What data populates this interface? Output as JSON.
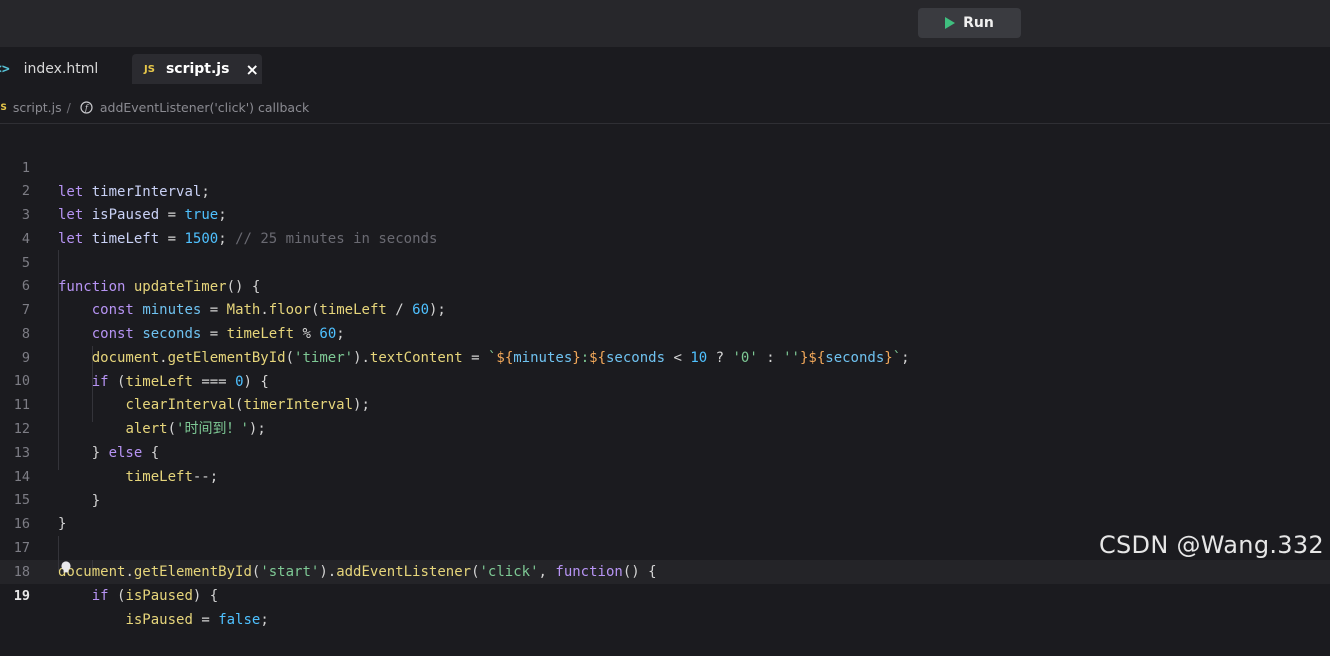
{
  "toolbar": {
    "run_label": "Run"
  },
  "tabs": [
    {
      "label": "index.html",
      "icon": "html-tag-icon",
      "icon_text": "<>"
    },
    {
      "label": "script.js",
      "icon": "js-file-icon",
      "icon_text": "JS",
      "active": true
    }
  ],
  "breadcrumb": {
    "file_badge": "JS",
    "file": "script.js",
    "separator": "/",
    "symbol": "addEventListener('click') callback"
  },
  "editor": {
    "active_line": 19,
    "line_numbers": [
      "1",
      "2",
      "3",
      "4",
      "5",
      "6",
      "7",
      "8",
      "9",
      "10",
      "11",
      "12",
      "13",
      "14",
      "15",
      "16",
      "17",
      "18",
      "19"
    ]
  },
  "code": {
    "l1": [
      "let",
      "timerInterval",
      ";"
    ],
    "l2": [
      "let",
      "isPaused",
      "=",
      "true",
      ";"
    ],
    "l3": [
      "let",
      "timeLeft",
      "=",
      "1500",
      ";",
      "// 25 minutes in seconds"
    ],
    "l5": [
      "function",
      "updateTimer",
      "() {"
    ],
    "l6": [
      "const",
      "minutes",
      "=",
      "Math",
      ".",
      "floor",
      "(",
      "timeLeft",
      "/",
      "60",
      ");"
    ],
    "l7": [
      "const",
      "seconds",
      "=",
      "timeLeft",
      "%",
      "60",
      ";"
    ],
    "l8": [
      "document",
      ".",
      "getElementById",
      "(",
      "'timer'",
      ").",
      "textContent",
      "=",
      "`",
      "${",
      "minutes",
      "}",
      ":",
      "${",
      "seconds",
      "<",
      "10",
      "?",
      "'0'",
      ":",
      "''",
      "}",
      "${",
      "seconds",
      "}",
      "`",
      ";"
    ],
    "l9": [
      "if",
      "(",
      "timeLeft",
      "===",
      "0",
      ") {"
    ],
    "l10": [
      "clearInterval",
      "(",
      "timerInterval",
      ");"
    ],
    "l11": [
      "alert",
      "(",
      "'时间到！'",
      ");"
    ],
    "l12": [
      "} ",
      "else",
      " {"
    ],
    "l13": [
      "timeLeft",
      "--;"
    ],
    "l14": [
      "}"
    ],
    "l15": [
      "}"
    ],
    "l17": [
      "document",
      ".",
      "getElementById",
      "(",
      "'start'",
      ").",
      "addEventListener",
      "(",
      "'click'",
      ",",
      "function",
      "() {"
    ],
    "l18": [
      "if",
      "(",
      "isPaused",
      ") {"
    ],
    "l19": [
      "isPaused",
      "=",
      "false",
      ";"
    ]
  },
  "watermark": "CSDN @Wang.332",
  "colors": {
    "background": "#1b1b1f",
    "keyword": "#b794f4",
    "string": "#7ec995",
    "number": "#4fc1ff",
    "function": "#e6d57b",
    "comment": "#6a6a72"
  }
}
